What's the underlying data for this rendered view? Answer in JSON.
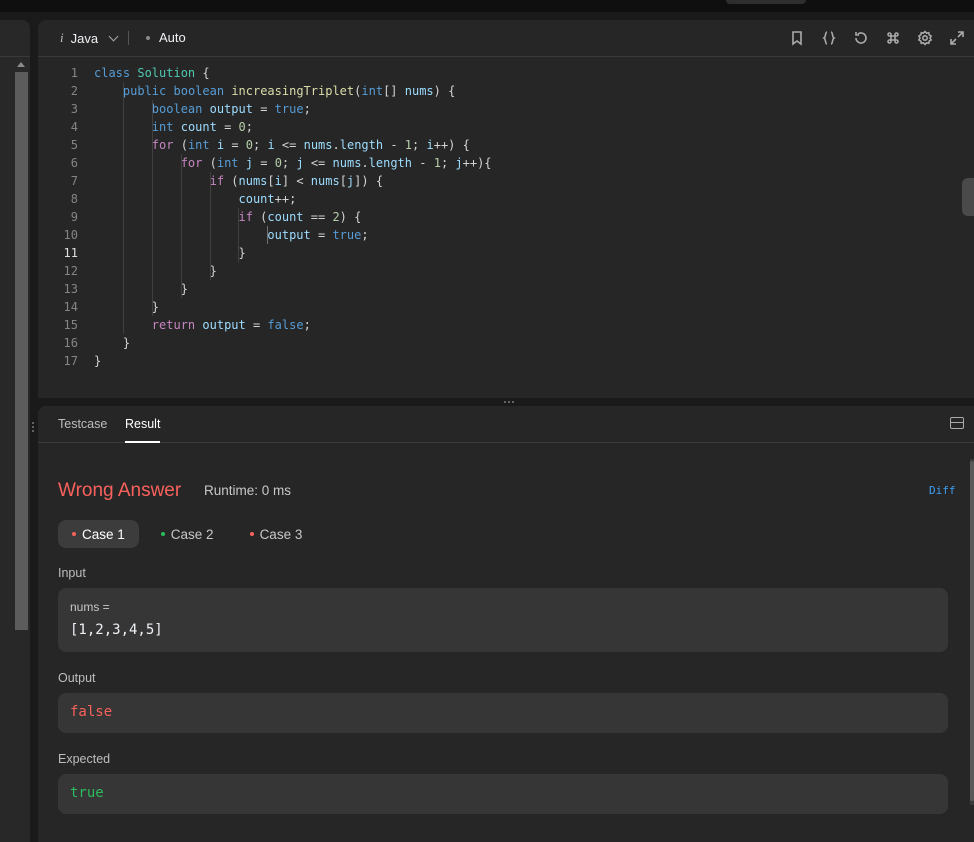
{
  "editor": {
    "language": "Java",
    "mode": "Auto",
    "language_icon": "i",
    "toolbar_icons": [
      "bookmark-icon",
      "braces-icon",
      "reset-icon",
      "command-icon",
      "settings-icon",
      "expand-icon"
    ],
    "current_line": 11,
    "lines": [
      [
        [
          "kw",
          "class"
        ],
        [
          "pl",
          " "
        ],
        [
          "ty",
          "Solution"
        ],
        [
          "pl",
          " {"
        ]
      ],
      [
        [
          "pl",
          "    "
        ],
        [
          "kw",
          "public"
        ],
        [
          "pl",
          " "
        ],
        [
          "kw",
          "boolean"
        ],
        [
          "pl",
          " "
        ],
        [
          "fn",
          "increasingTriplet"
        ],
        [
          "pl",
          "("
        ],
        [
          "kw",
          "int"
        ],
        [
          "pl",
          "[] "
        ],
        [
          "var",
          "nums"
        ],
        [
          "pl",
          ") {"
        ]
      ],
      [
        [
          "pl",
          "        "
        ],
        [
          "kw",
          "boolean"
        ],
        [
          "pl",
          " "
        ],
        [
          "var",
          "output"
        ],
        [
          "pl",
          " = "
        ],
        [
          "kw",
          "true"
        ],
        [
          "pl",
          ";"
        ]
      ],
      [
        [
          "pl",
          "        "
        ],
        [
          "kw",
          "int"
        ],
        [
          "pl",
          " "
        ],
        [
          "var",
          "count"
        ],
        [
          "pl",
          " = "
        ],
        [
          "num",
          "0"
        ],
        [
          "pl",
          ";"
        ]
      ],
      [
        [
          "pl",
          "        "
        ],
        [
          "ctl",
          "for"
        ],
        [
          "pl",
          " ("
        ],
        [
          "kw",
          "int"
        ],
        [
          "pl",
          " "
        ],
        [
          "var",
          "i"
        ],
        [
          "pl",
          " = "
        ],
        [
          "num",
          "0"
        ],
        [
          "pl",
          "; "
        ],
        [
          "var",
          "i"
        ],
        [
          "pl",
          " <= "
        ],
        [
          "var",
          "nums"
        ],
        [
          "pl",
          "."
        ],
        [
          "var",
          "length"
        ],
        [
          "pl",
          " - "
        ],
        [
          "num",
          "1"
        ],
        [
          "pl",
          "; "
        ],
        [
          "var",
          "i"
        ],
        [
          "pl",
          "++) {"
        ]
      ],
      [
        [
          "pl",
          "            "
        ],
        [
          "ctl",
          "for"
        ],
        [
          "pl",
          " ("
        ],
        [
          "kw",
          "int"
        ],
        [
          "pl",
          " "
        ],
        [
          "var",
          "j"
        ],
        [
          "pl",
          " = "
        ],
        [
          "num",
          "0"
        ],
        [
          "pl",
          "; "
        ],
        [
          "var",
          "j"
        ],
        [
          "pl",
          " <= "
        ],
        [
          "var",
          "nums"
        ],
        [
          "pl",
          "."
        ],
        [
          "var",
          "length"
        ],
        [
          "pl",
          " - "
        ],
        [
          "num",
          "1"
        ],
        [
          "pl",
          "; "
        ],
        [
          "var",
          "j"
        ],
        [
          "pl",
          "++){"
        ]
      ],
      [
        [
          "pl",
          "                "
        ],
        [
          "ctl",
          "if"
        ],
        [
          "pl",
          " ("
        ],
        [
          "var",
          "nums"
        ],
        [
          "pl",
          "["
        ],
        [
          "var",
          "i"
        ],
        [
          "pl",
          "] < "
        ],
        [
          "var",
          "nums"
        ],
        [
          "pl",
          "["
        ],
        [
          "var",
          "j"
        ],
        [
          "pl",
          "]) {"
        ]
      ],
      [
        [
          "pl",
          "                    "
        ],
        [
          "var",
          "count"
        ],
        [
          "pl",
          "++;"
        ]
      ],
      [
        [
          "pl",
          "                    "
        ],
        [
          "ctl",
          "if"
        ],
        [
          "pl",
          " ("
        ],
        [
          "var",
          "count"
        ],
        [
          "pl",
          " == "
        ],
        [
          "num",
          "2"
        ],
        [
          "pl",
          ") {"
        ]
      ],
      [
        [
          "pl",
          "                        "
        ],
        [
          "var",
          "output"
        ],
        [
          "pl",
          " = "
        ],
        [
          "kw",
          "true"
        ],
        [
          "pl",
          ";"
        ]
      ],
      [
        [
          "pl",
          "                    }"
        ]
      ],
      [
        [
          "pl",
          "                }"
        ]
      ],
      [
        [
          "pl",
          "            }"
        ]
      ],
      [
        [
          "pl",
          "        }"
        ]
      ],
      [
        [
          "pl",
          "        "
        ],
        [
          "ctl",
          "return"
        ],
        [
          "pl",
          " "
        ],
        [
          "var",
          "output"
        ],
        [
          "pl",
          " = "
        ],
        [
          "kw",
          "false"
        ],
        [
          "pl",
          ";"
        ]
      ],
      [
        [
          "pl",
          "    }"
        ]
      ],
      [
        [
          "pl",
          "}"
        ]
      ]
    ]
  },
  "result": {
    "tabs": {
      "testcase": "Testcase",
      "result": "Result"
    },
    "verdict": "Wrong Answer",
    "runtime": "Runtime: 0 ms",
    "diff": "Diff",
    "cases": [
      {
        "label": "Case 1",
        "status": "fail"
      },
      {
        "label": "Case 2",
        "status": "pass"
      },
      {
        "label": "Case 3",
        "status": "fail"
      }
    ],
    "input_label": "Input",
    "input_name": "nums =",
    "input_value": "[1,2,3,4,5]",
    "output_label": "Output",
    "output_value": "false",
    "expected_label": "Expected",
    "expected_value": "true",
    "colors": {
      "fail": "#f8615c",
      "pass": "#2cbb5d"
    }
  }
}
